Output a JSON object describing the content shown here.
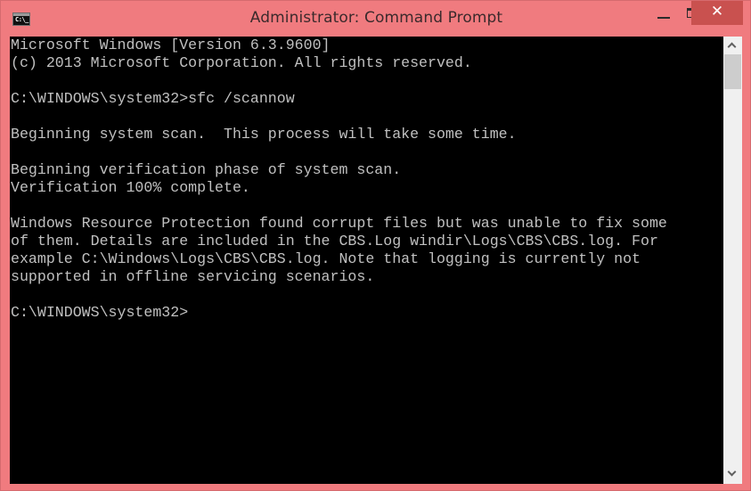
{
  "window": {
    "title": "Administrator: Command Prompt",
    "icon": "cmd-icon",
    "icon_glyph": "C:\\_",
    "controls": {
      "minimize": "minimize-icon",
      "maximize": "maximize-icon",
      "close": "close-icon",
      "close_glyph": "✕"
    },
    "colors": {
      "frame": "#f07b7f",
      "close_button": "#c9514f",
      "console_bg": "#000000",
      "console_text": "#c0c0c0"
    }
  },
  "console": {
    "lines": [
      "Microsoft Windows [Version 6.3.9600]",
      "(c) 2013 Microsoft Corporation. All rights reserved.",
      "",
      "C:\\WINDOWS\\system32>sfc /scannow",
      "",
      "Beginning system scan.  This process will take some time.",
      "",
      "Beginning verification phase of system scan.",
      "Verification 100% complete.",
      "",
      "Windows Resource Protection found corrupt files but was unable to fix some",
      "of them. Details are included in the CBS.Log windir\\Logs\\CBS\\CBS.log. For",
      "example C:\\Windows\\Logs\\CBS\\CBS.log. Note that logging is currently not",
      "supported in offline servicing scenarios.",
      "",
      "C:\\WINDOWS\\system32>"
    ]
  },
  "scrollbar": {
    "up": "chevron-up-icon",
    "down": "chevron-down-icon",
    "position_fraction": 0.0
  }
}
